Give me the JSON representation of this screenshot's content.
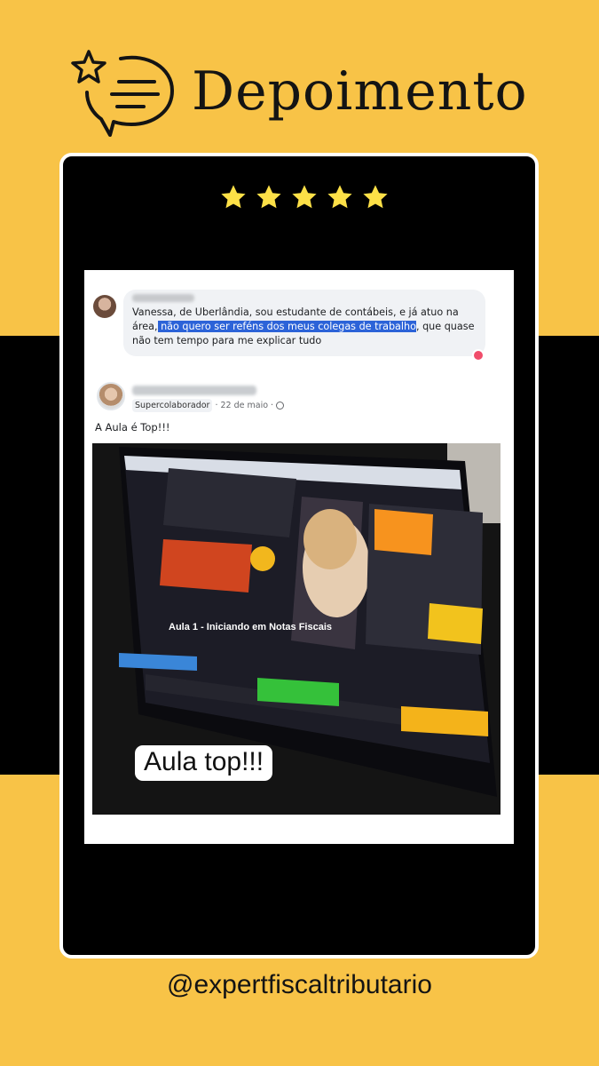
{
  "header": {
    "title": "Depoimento",
    "icon": "chat-star-icon"
  },
  "rating": {
    "stars": 5,
    "star_color": "#fde047"
  },
  "comment": {
    "text_before": "Vanessa, de Uberlândia, sou estudante de contábeis, e já atuo na área,",
    "text_highlight": " não quero ser reféns dos meus colegas de trabalho",
    "text_after": ", que quase não tem tempo para me explicar tudo"
  },
  "post": {
    "badge": "Supercolaborador",
    "date": "· 22 de maio ·",
    "text": "A Aula é Top!!!",
    "photo_caption": "Aula top!!!"
  },
  "footer": {
    "handle": "@expertfiscaltributario"
  },
  "colors": {
    "background": "#f8c347",
    "band": "#000000",
    "highlight": "#2c63d8"
  }
}
